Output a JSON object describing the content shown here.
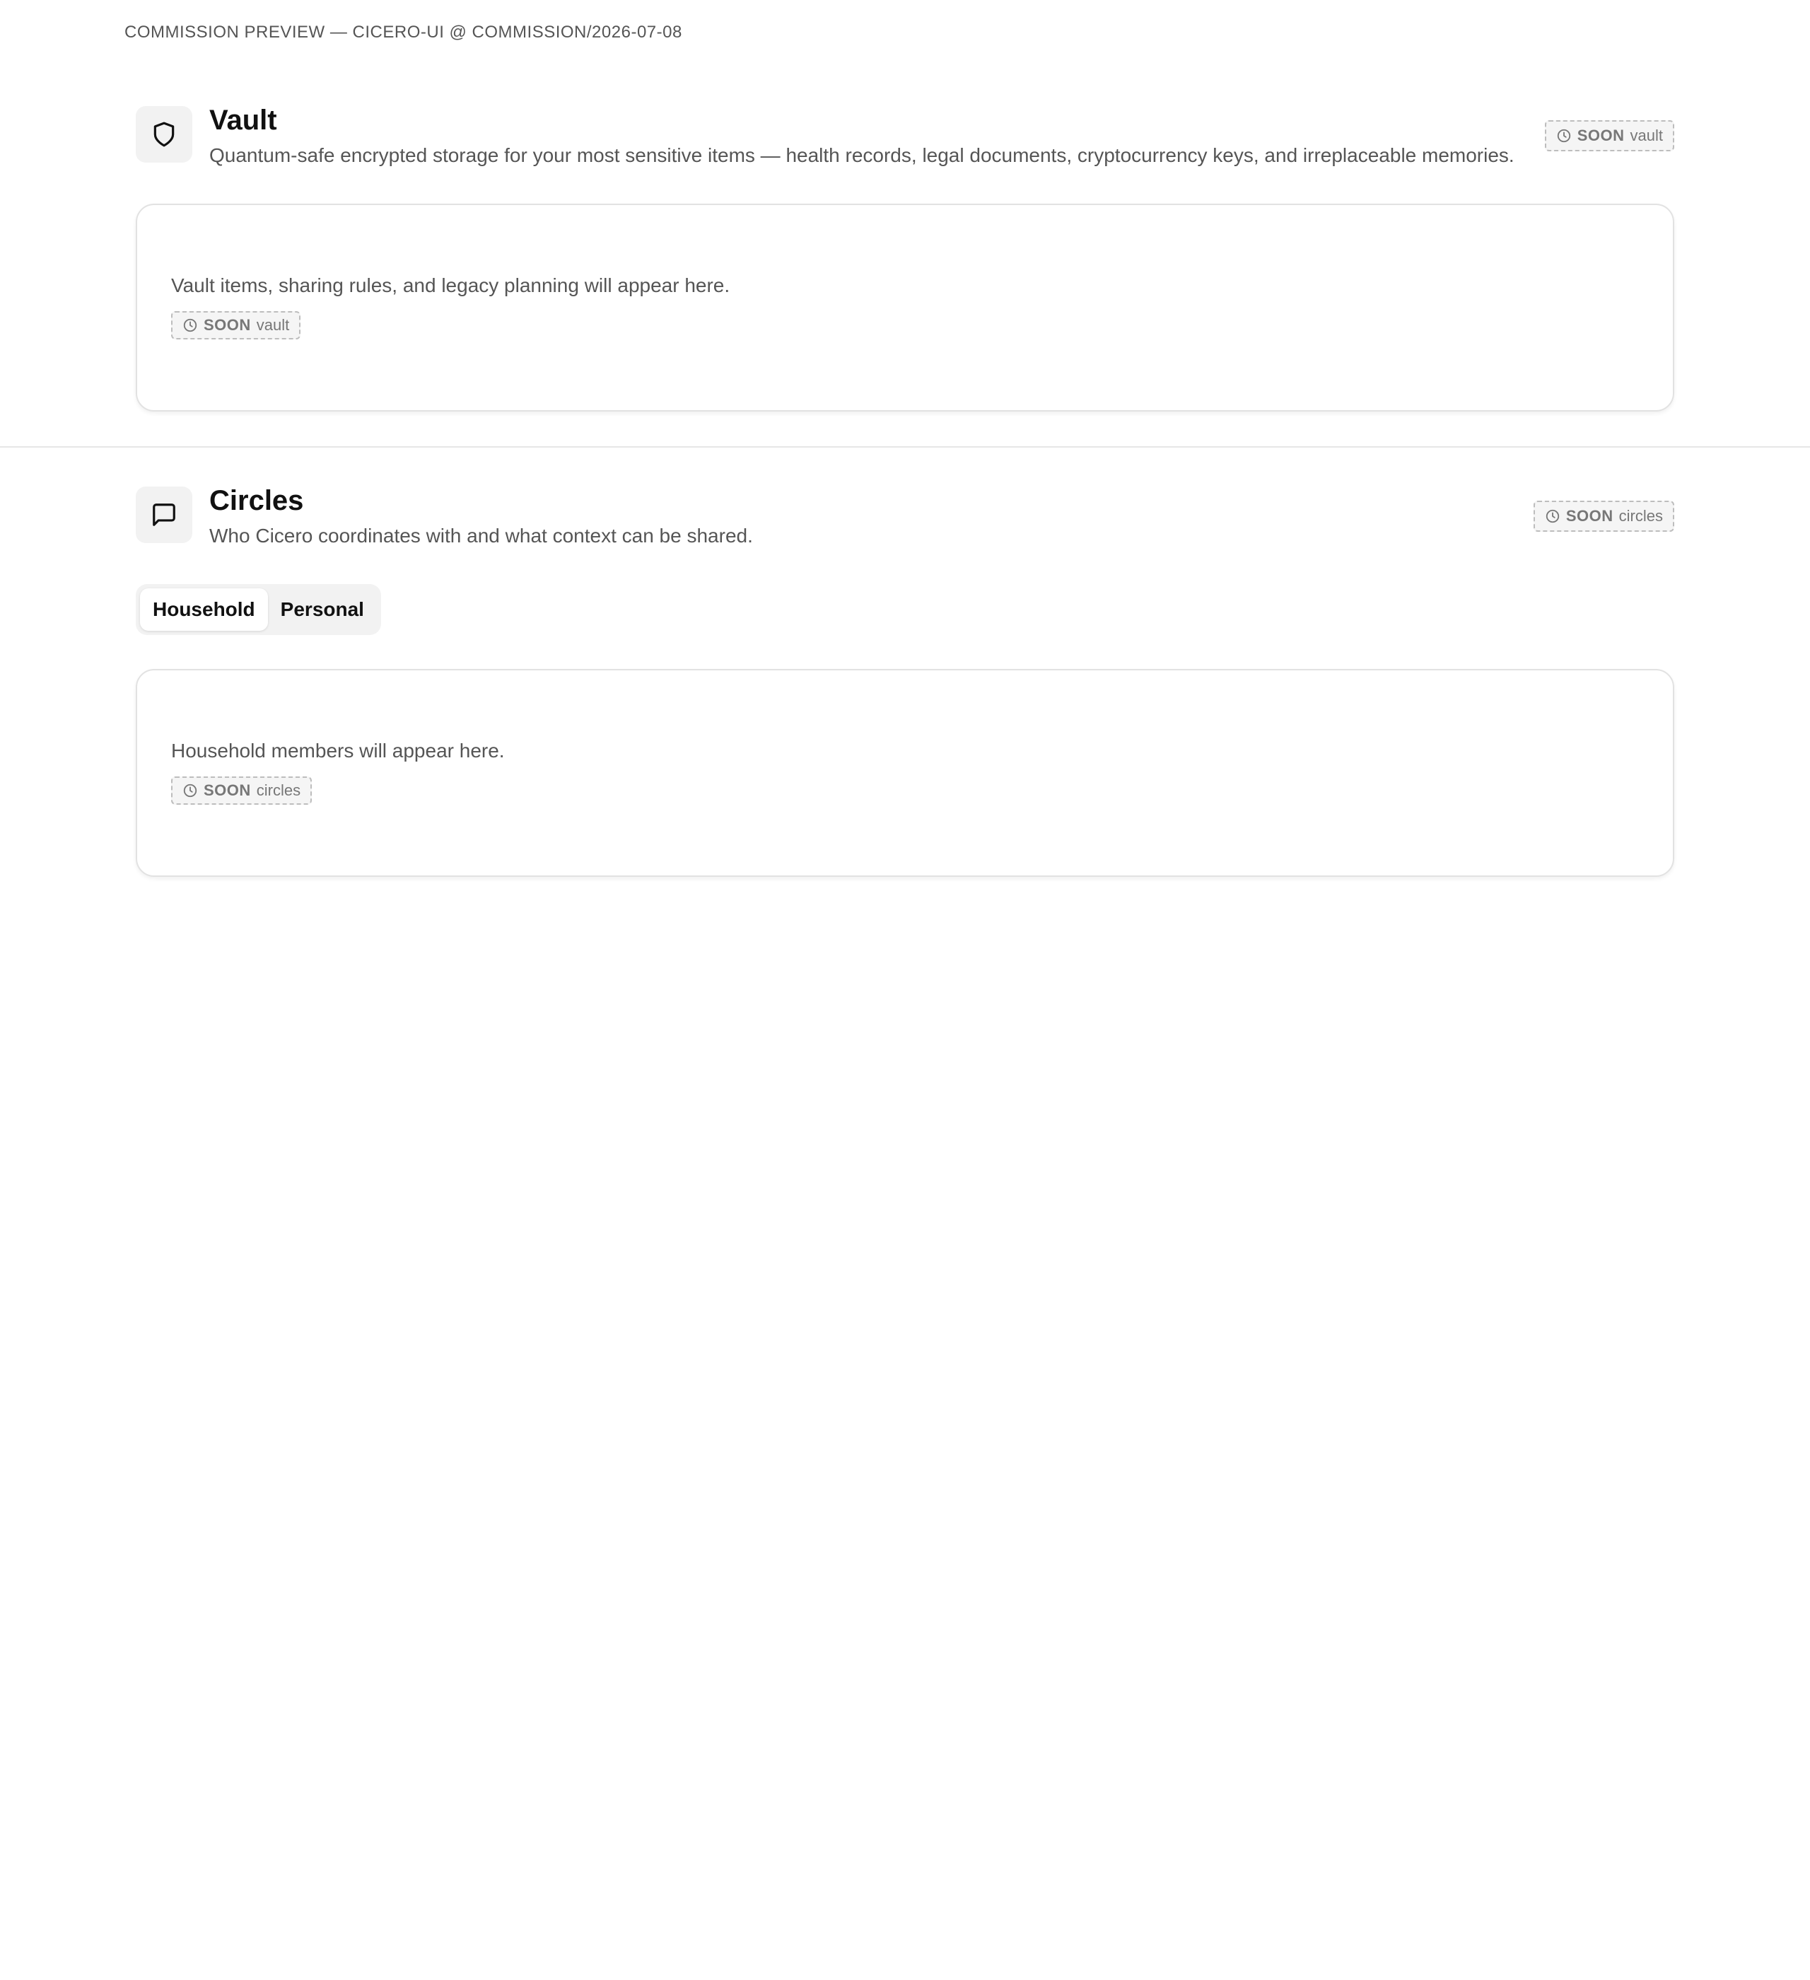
{
  "preview_bar": {
    "text": "COMMISSION PREVIEW — CICERO-UI @ COMMISSION/2026-07-08"
  },
  "vault": {
    "icon": "shield-icon",
    "title": "Vault",
    "description": "Quantum-safe encrypted storage for your most sensitive items — health records, legal documents, cryptocurrency keys, and irreplaceable memories.",
    "badge": {
      "icon": "clock-icon",
      "status": "SOON",
      "label": "vault"
    },
    "card": {
      "text": "Vault items, sharing rules, and legacy planning will appear here.",
      "badge": {
        "icon": "clock-icon",
        "status": "SOON",
        "label": "vault"
      }
    }
  },
  "circles": {
    "icon": "message-icon",
    "title": "Circles",
    "description": "Who Cicero coordinates with and what context can be shared.",
    "badge": {
      "icon": "clock-icon",
      "status": "SOON",
      "label": "circles"
    },
    "tabs": [
      {
        "label": "Household",
        "active": true
      },
      {
        "label": "Personal",
        "active": false
      }
    ],
    "card": {
      "text": "Household members will appear here.",
      "badge": {
        "icon": "clock-icon",
        "status": "SOON",
        "label": "circles"
      }
    }
  },
  "colors": {
    "text_primary": "#111111",
    "text_secondary": "#555555",
    "badge_text": "#777777",
    "badge_border": "#bdbdbd",
    "icon_tile_bg": "#f2f2f2",
    "card_border": "#e2e2e2"
  }
}
